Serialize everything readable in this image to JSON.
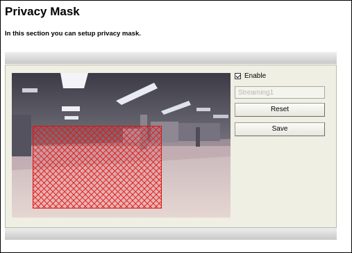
{
  "header": {
    "title": "Privacy Mask",
    "subtitle": "In this section you can setup privacy mask."
  },
  "controls": {
    "enable_label": "Enable",
    "enable_checked": true,
    "stream_value": "Streaming1",
    "reset_label": "Reset",
    "save_label": "Save"
  },
  "colors": {
    "mask_border": "#e01010",
    "panel_bg": "#efefe4"
  }
}
